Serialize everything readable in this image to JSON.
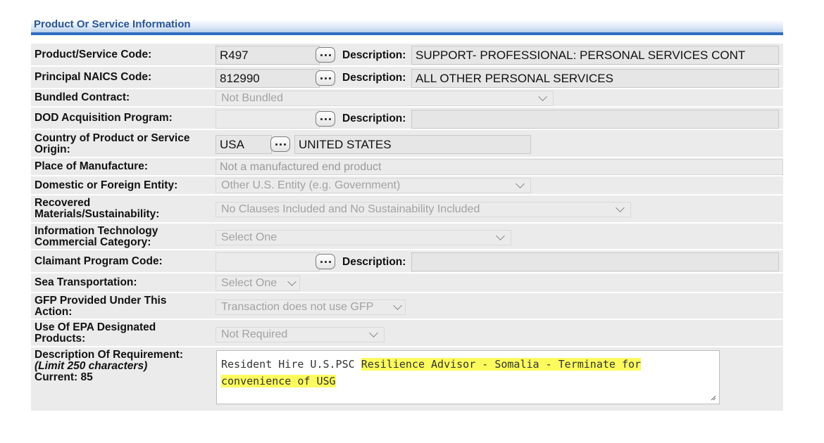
{
  "section": {
    "title": "Product Or Service Information"
  },
  "rows": {
    "psc": {
      "label": "Product/Service Code:",
      "value": "R497",
      "desc_label": "Description:",
      "desc_value": "SUPPORT- PROFESSIONAL: PERSONAL SERVICES CONT"
    },
    "naics": {
      "label": "Principal NAICS Code:",
      "value": "812990",
      "desc_label": "Description:",
      "desc_value": "ALL OTHER PERSONAL SERVICES"
    },
    "bundled": {
      "label": "Bundled Contract:",
      "value": "Not Bundled"
    },
    "dod": {
      "label": "DOD Acquisition Program:",
      "value": "",
      "desc_label": "Description:",
      "desc_value": ""
    },
    "country": {
      "label": "Country of Product or Service Origin:",
      "code": "USA",
      "name": "UNITED STATES"
    },
    "place": {
      "label": "Place of Manufacture:",
      "value": "Not a manufactured end product"
    },
    "domestic": {
      "label": "Domestic or Foreign Entity:",
      "value": "Other U.S. Entity (e.g. Government)"
    },
    "recovered": {
      "label": "Recovered Materials/Sustainability:",
      "value": "No Clauses Included and No Sustainability Included"
    },
    "it": {
      "label": "Information Technology Commercial Category:",
      "value": "Select One"
    },
    "claimant": {
      "label": "Claimant Program Code:",
      "value": "",
      "desc_label": "Description:",
      "desc_value": ""
    },
    "sea": {
      "label": "Sea Transportation:",
      "value": "Select One"
    },
    "gfp": {
      "label": "GFP Provided Under This Action:",
      "value": "Transaction does not use GFP"
    },
    "epa": {
      "label": "Use Of EPA Designated Products:",
      "value": "Not Required"
    },
    "requirement": {
      "label": "Description Of Requirement:",
      "limit": "(Limit 250 characters)",
      "current": "Current: 85",
      "text_plain": "Resident Hire U.S.PSC ",
      "text_highlight_1": "Resilience Advisor - Somalia - Terminate for",
      "text_highlight_2": "convenience of USG"
    }
  },
  "colors": {
    "highlight": "#fbfb5e",
    "header_bar": "#2e6fc0",
    "header_text": "#2a5595"
  }
}
